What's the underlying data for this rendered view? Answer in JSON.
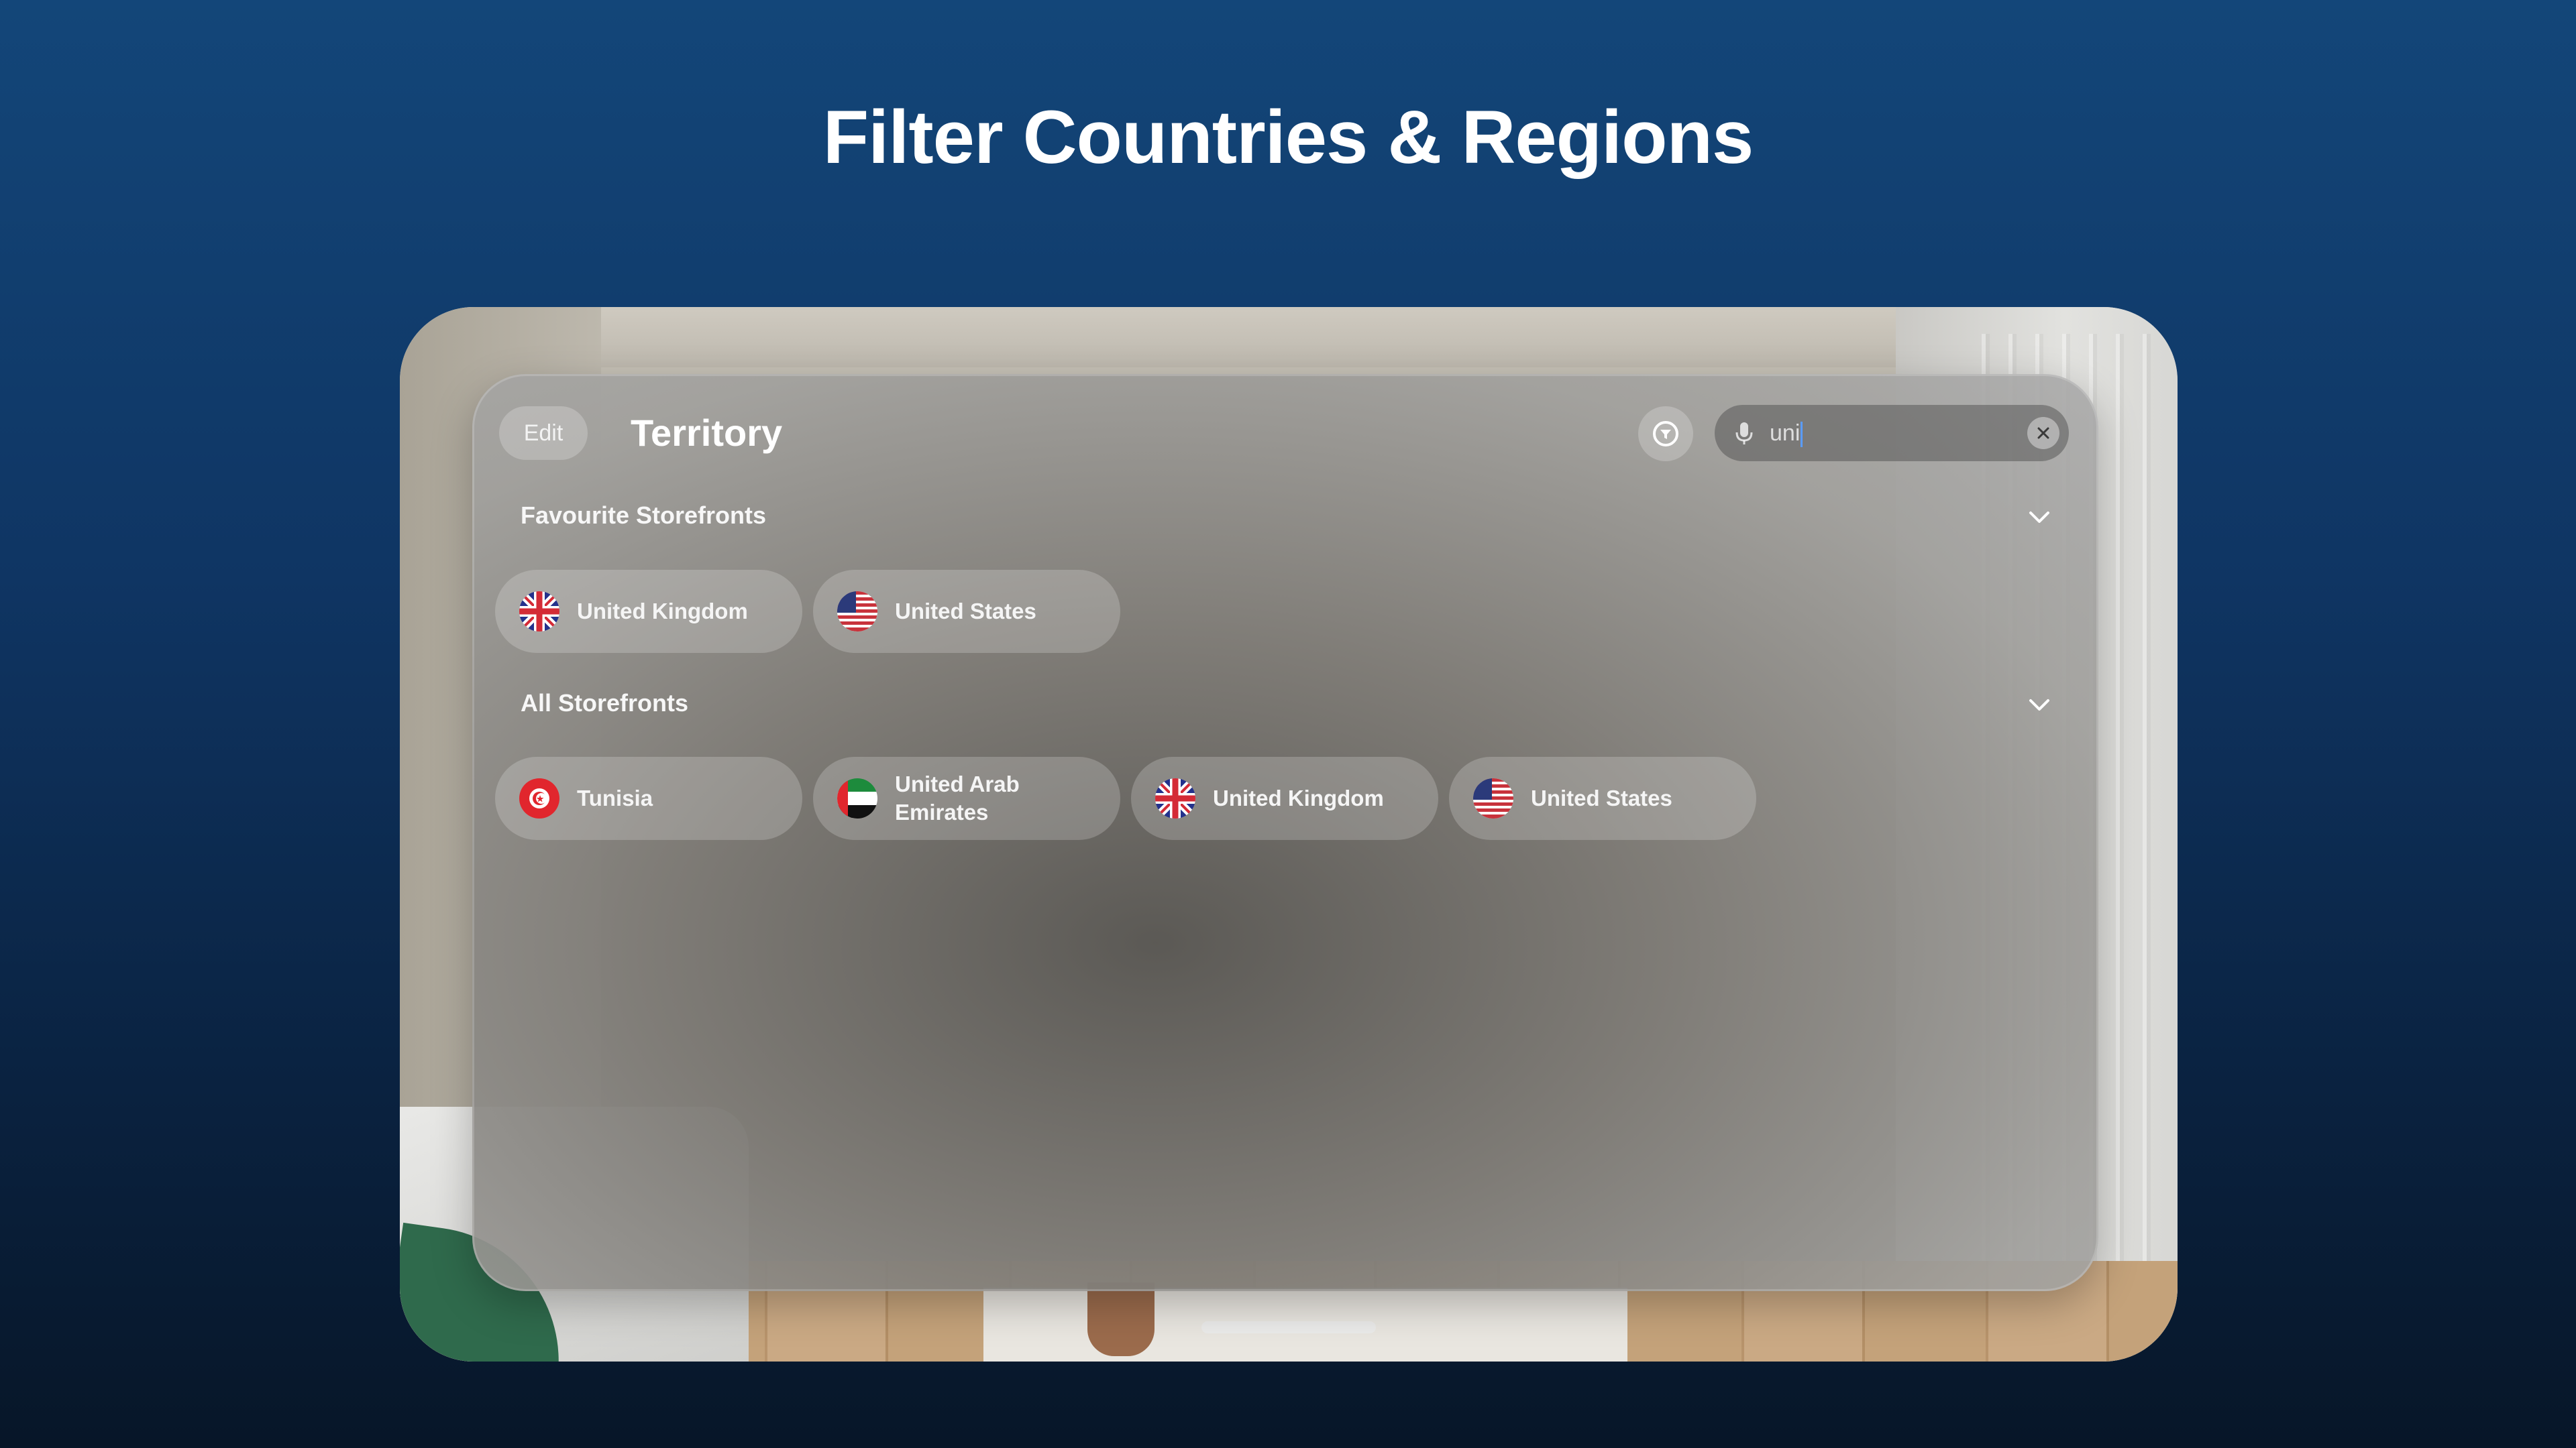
{
  "hero": {
    "title": "Filter Countries & Regions"
  },
  "window": {
    "edit_label": "Edit",
    "title": "Territory",
    "filter_icon": "filter-circle-icon",
    "search": {
      "value": "uni",
      "mic_icon": "microphone-icon",
      "clear_icon": "xmark-circle-icon"
    }
  },
  "favourites": {
    "title": "Favourite Storefronts",
    "items": [
      {
        "label": "United Kingdom",
        "flag": "uk-flag-icon"
      },
      {
        "label": "United States",
        "flag": "us-flag-icon"
      }
    ]
  },
  "all": {
    "title": "All Storefronts",
    "items": [
      {
        "label": "Tunisia",
        "flag": "tunisia-flag-icon"
      },
      {
        "label": "United Arab Emirates",
        "flag": "uae-flag-icon"
      },
      {
        "label": "United Kingdom",
        "flag": "uk-flag-icon"
      },
      {
        "label": "United States",
        "flag": "us-flag-icon"
      }
    ]
  }
}
